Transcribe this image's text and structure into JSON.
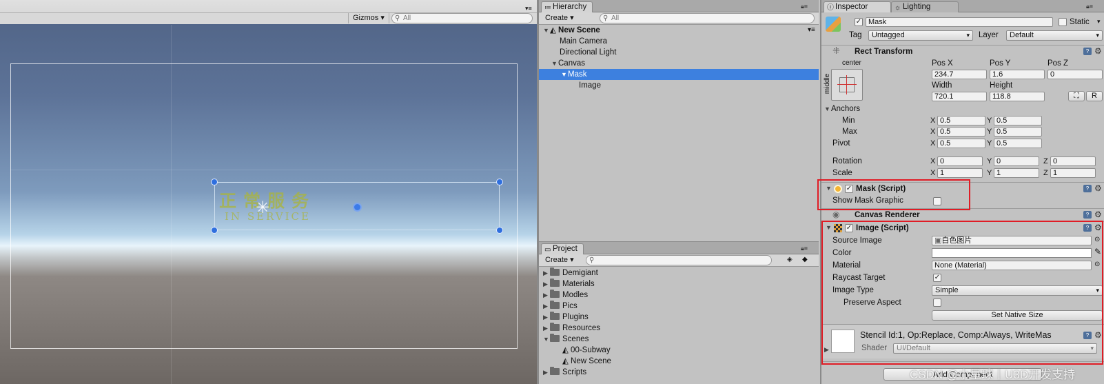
{
  "scene": {
    "gizmos_label": "Gizmos",
    "search_placeholder": "All",
    "canvas_text_cn": "正常服务",
    "canvas_text_en": "IN SERVICE"
  },
  "hierarchy": {
    "tab_label": "Hierarchy",
    "create_label": "Create",
    "search_placeholder": "All",
    "scene_name": "New Scene",
    "items": [
      {
        "label": "Main Camera"
      },
      {
        "label": "Directional Light"
      },
      {
        "label": "Canvas"
      },
      {
        "label": "Mask"
      },
      {
        "label": "Image"
      }
    ]
  },
  "project": {
    "tab_label": "Project",
    "create_label": "Create",
    "folders": [
      "Demigiant",
      "Materials",
      "Modles",
      "Pics",
      "Plugins",
      "Resources",
      "Scenes"
    ],
    "scene_files": [
      "00-Subway",
      "New Scene"
    ],
    "folders_after": [
      "Scripts"
    ]
  },
  "inspector": {
    "tab_inspector": "Inspector",
    "tab_lighting": "Lighting",
    "object_name": "Mask",
    "static_label": "Static",
    "tag_label": "Tag",
    "tag_value": "Untagged",
    "layer_label": "Layer",
    "layer_value": "Default",
    "rect_transform": {
      "title": "Rect Transform",
      "anchor_h": "center",
      "anchor_v": "middle",
      "pos_x_label": "Pos X",
      "pos_y_label": "Pos Y",
      "pos_z_label": "Pos Z",
      "pos_x": "234.7",
      "pos_y": "1.6",
      "pos_z": "0",
      "width_label": "Width",
      "height_label": "Height",
      "width": "720.1",
      "height": "118.8",
      "r_button": "R",
      "anchors_label": "Anchors",
      "min_label": "Min",
      "max_label": "Max",
      "pivot_label": "Pivot",
      "min_x": "0.5",
      "min_y": "0.5",
      "max_x": "0.5",
      "max_y": "0.5",
      "pivot_x": "0.5",
      "pivot_y": "0.5",
      "rotation_label": "Rotation",
      "scale_label": "Scale",
      "rot_x": "0",
      "rot_y": "0",
      "rot_z": "0",
      "scale_x": "1",
      "scale_y": "1",
      "scale_z": "1",
      "x": "X",
      "y": "Y",
      "z": "Z"
    },
    "mask_script": {
      "title": "Mask (Script)",
      "show_mask_graphic_label": "Show Mask Graphic"
    },
    "canvas_renderer": {
      "title": "Canvas Renderer"
    },
    "image_script": {
      "title": "Image (Script)",
      "source_image_label": "Source Image",
      "source_image_value": "白色图片",
      "color_label": "Color",
      "material_label": "Material",
      "material_value": "None (Material)",
      "raycast_label": "Raycast Target",
      "image_type_label": "Image Type",
      "image_type_value": "Simple",
      "preserve_label": "Preserve Aspect",
      "native_size_button": "Set Native Size"
    },
    "material_preview": {
      "stencil_text": "Stencil Id:1, Op:Replace, Comp:Always, WriteMas",
      "shader_label": "Shader",
      "shader_value": "UI/Default"
    },
    "add_component": "Add Component"
  },
  "watermark": "CSDN @小星球丨U3D开发支持",
  "colors": {
    "selection": "#3d80df",
    "highlight_box": "#e01c25"
  }
}
